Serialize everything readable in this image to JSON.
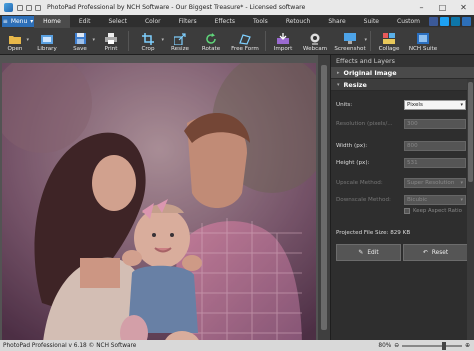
{
  "window": {
    "title": "PhotoPad Professional by NCH Software - Our Biggest Treasure* - Licensed software",
    "minimize": "–",
    "maximize": "□",
    "close": "✕"
  },
  "menubar": {
    "menu_label": "Menu",
    "tabs": [
      "Home",
      "Edit",
      "Select",
      "Color",
      "Filters",
      "Effects",
      "Tools",
      "Retouch",
      "Share",
      "Suite",
      "Custom"
    ],
    "active_tab": "Home"
  },
  "toolbar": {
    "items": [
      {
        "label": "Open",
        "icon": "folder-icon"
      },
      {
        "label": "Library",
        "icon": "library-icon"
      },
      {
        "label": "Save",
        "icon": "save-icon"
      },
      {
        "label": "Print",
        "icon": "print-icon"
      },
      {
        "label": "Crop",
        "icon": "crop-icon"
      },
      {
        "label": "Resize",
        "icon": "resize-icon"
      },
      {
        "label": "Rotate",
        "icon": "rotate-icon"
      },
      {
        "label": "Free Form",
        "icon": "free-form-icon"
      },
      {
        "label": "Import",
        "icon": "import-icon"
      },
      {
        "label": "Webcam",
        "icon": "webcam-icon"
      },
      {
        "label": "Screenshot",
        "icon": "screenshot-icon"
      },
      {
        "label": "Collage",
        "icon": "collage-icon"
      },
      {
        "label": "NCH Suite",
        "icon": "nch-suite-icon"
      }
    ]
  },
  "panel": {
    "title": "Effects and Layers",
    "original_image": "Original Image",
    "resize_section": "Resize",
    "fields": {
      "units_label": "Units:",
      "units_value": "Pixels",
      "resolution_label": "Resolution (pixels/...",
      "resolution_value": "300",
      "width_label": "Width (px):",
      "width_value": "800",
      "height_label": "Height (px):",
      "height_value": "531",
      "upscale_label": "Upscale Method:",
      "upscale_value": "Super Resolution",
      "downscale_label": "Downscale Method:",
      "downscale_value": "Bicubic"
    },
    "keep_aspect": "Keep Aspect Ratio",
    "projected": "Projected File Size: 829 KB",
    "edit_button": "Edit",
    "reset_button": "Reset"
  },
  "statusbar": {
    "text": "PhotoPad Professional v 6.18 © NCH Software",
    "zoom": "80%"
  }
}
